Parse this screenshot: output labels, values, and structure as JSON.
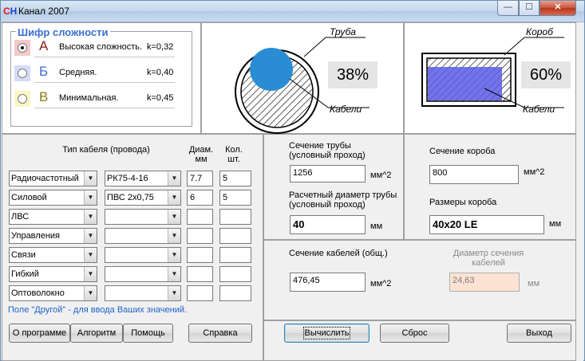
{
  "window": {
    "title": "Канал 2007",
    "icon_text": [
      "C",
      "H"
    ],
    "minimize_glyph": "—",
    "maximize_glyph": "☐",
    "close_glyph": "✕"
  },
  "complexity": {
    "title": "Шифр сложности",
    "levels": [
      {
        "letter": "А",
        "label": "Высокая сложность.",
        "k": "k=0,32",
        "checked": true,
        "letter_color": "#8b1a1a",
        "radio_bg": "#f3c9c9"
      },
      {
        "letter": "Б",
        "label": "Средняя.",
        "k": "k=0,40",
        "checked": false,
        "letter_color": "#3a6fd0",
        "radio_bg": "#d6dcf6"
      },
      {
        "letter": "В",
        "label": "Минимальная.",
        "k": "k=0,45",
        "checked": false,
        "letter_color": "#8a7a1a",
        "radio_bg": "#fbf5c2"
      }
    ]
  },
  "pipe_diagram": {
    "pipe_label": "Труба",
    "cables_label": "Кабели",
    "percent": "38%",
    "fill_color": "#2a8dd4"
  },
  "box_diagram": {
    "box_label": "Короб",
    "cables_label": "Кабели",
    "percent": "60%",
    "fill_color": "#5b5be6"
  },
  "cables": {
    "header_type": "Тип кабеля (провода)",
    "header_diam": "Диам. мм",
    "header_count": "Кол. шт.",
    "rows": [
      {
        "type": "Радиочастотный",
        "brand": "РК75-4-16",
        "diam": "7.7",
        "count": "5"
      },
      {
        "type": "Силовой",
        "brand": "ПВС 2х0,75",
        "diam": "6",
        "count": "5"
      },
      {
        "type": "ЛВС",
        "brand": "",
        "diam": "",
        "count": ""
      },
      {
        "type": "Управления",
        "brand": "",
        "diam": "",
        "count": ""
      },
      {
        "type": "Связи",
        "brand": "",
        "diam": "",
        "count": ""
      },
      {
        "type": "Гибкий",
        "brand": "",
        "diam": "",
        "count": ""
      },
      {
        "type": "Оптоволокно",
        "brand": "",
        "diam": "",
        "count": ""
      }
    ],
    "hint": "Поле \"Другой\" - для ввода Ваших значений."
  },
  "pipe_calc": {
    "section_label": "Сечение трубы\n(условный проход)",
    "section_value": "1256",
    "section_unit": "мм^2",
    "diam_label": "Расчетный диаметр трубы\n(условный проход)",
    "diam_value": "40",
    "diam_unit": "мм"
  },
  "box_calc": {
    "section_label": "Сечение короба",
    "section_value": "800",
    "section_unit": "мм^2",
    "size_label": "Размеры короба",
    "size_value": "40х20 LE",
    "size_unit": "мм"
  },
  "cable_calc": {
    "section_label": "Сечение кабелей (общ.)",
    "section_value": "476,45",
    "section_unit": "мм^2",
    "diam_label": "Диаметр сечения\nкабелей",
    "diam_value": "24,63",
    "diam_unit": "мм"
  },
  "buttons": {
    "about": "О программе",
    "algorithm": "Алгоритм",
    "help": "Помощь",
    "reference": "Справка",
    "calculate": "Вычислить",
    "reset": "Сброс",
    "exit": "Выход"
  },
  "icons": {
    "dropdown_arrow": "▼"
  }
}
